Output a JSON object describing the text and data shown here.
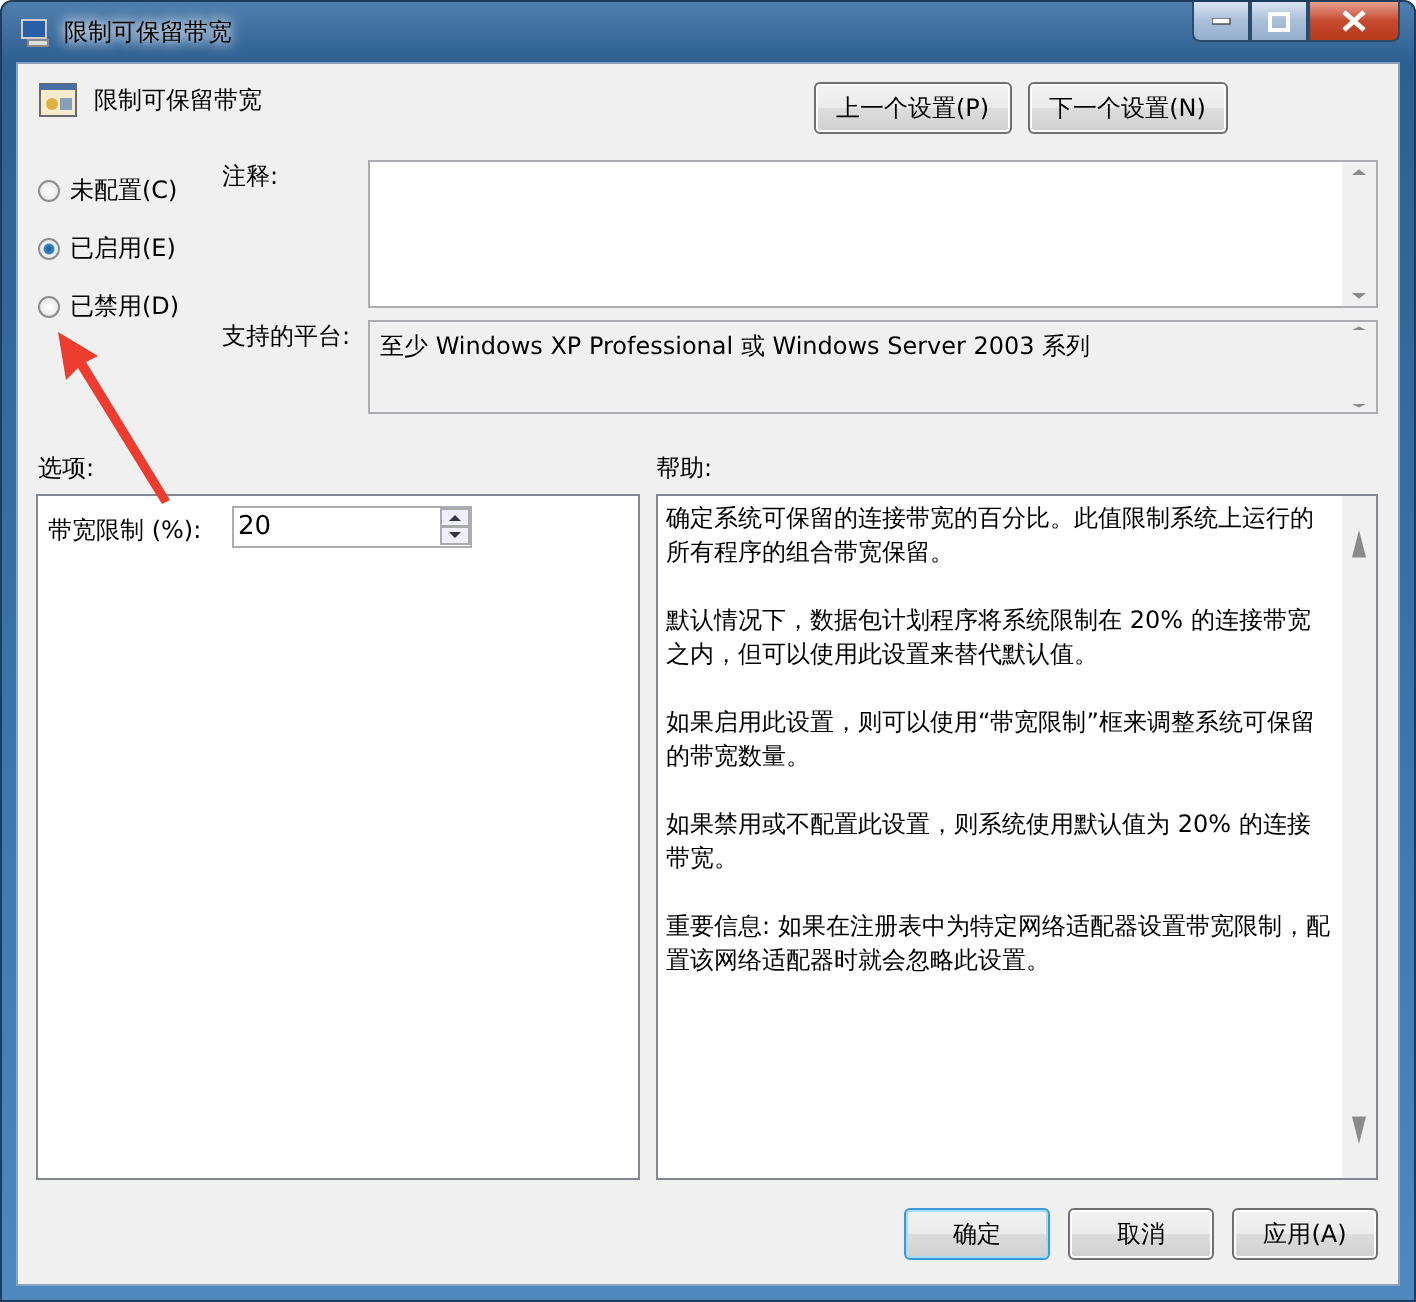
{
  "window": {
    "title": "限制可保留带宽"
  },
  "header": {
    "title": "限制可保留带宽"
  },
  "nav_buttons": [
    "上一个设置(P)",
    "下一个设置(N)"
  ],
  "radio_options": [
    {
      "label": "未配置(C)",
      "selected": false
    },
    {
      "label": "已启用(E)",
      "selected": true
    },
    {
      "label": "已禁用(D)",
      "selected": false
    }
  ],
  "comment": {
    "label": "注释:"
  },
  "platform": {
    "label": "支持的平台:",
    "value": "至少 Windows XP Professional 或 Windows Server 2003 系列"
  },
  "options": {
    "label": "选项:",
    "field_label": "带宽限制 (%):",
    "value": "20"
  },
  "help": {
    "label": "帮助:",
    "paragraphs": [
      "确定系统可保留的连接带宽的百分比。此值限制系统上运行的所有程序的组合带宽保留。",
      "默认情况下，数据包计划程序将系统限制在 20% 的连接带宽之内，但可以使用此设置来替代默认值。",
      "如果启用此设置，则可以使用“带宽限制”框来调整系统可保留的带宽数量。",
      "如果禁用或不配置此设置，则系统使用默认值为 20% 的连接带宽。",
      "重要信息: 如果在注册表中为特定网络适配器设置带宽限制，配置该网络适配器时就会忽略此设置。"
    ]
  },
  "footer_buttons": [
    {
      "label": "确定",
      "selected": true
    },
    {
      "label": "取消",
      "selected": false
    },
    {
      "label": "应用(A)",
      "selected": false
    }
  ]
}
